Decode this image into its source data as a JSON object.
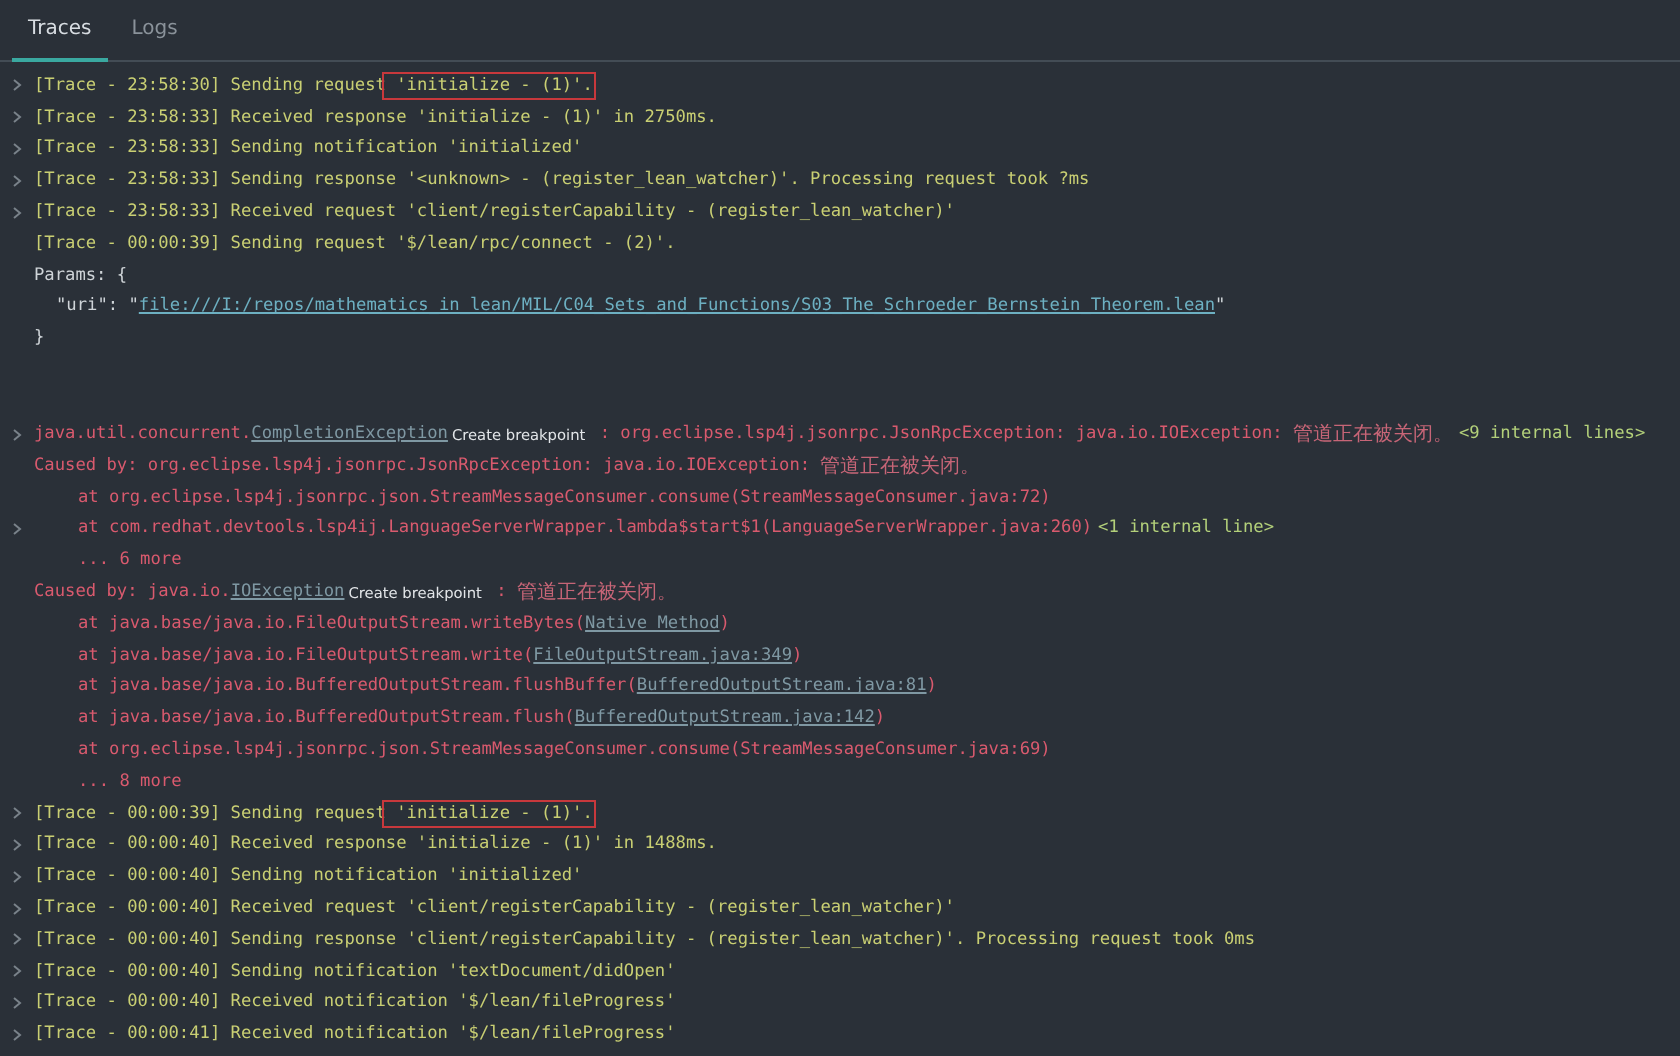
{
  "tabs": [
    {
      "label": "Traces",
      "selected": true
    },
    {
      "label": "Logs",
      "selected": false
    }
  ],
  "log": [
    {
      "kind": "trace",
      "expandable": true,
      "segments": [
        {
          "kind": "text",
          "text": "[Trace - 23:58:30] Sending request"
        },
        {
          "kind": "text",
          "text": " 'initialize - (1)'.",
          "boxed": true
        }
      ]
    },
    {
      "kind": "trace",
      "expandable": true,
      "segments": [
        {
          "kind": "text",
          "text": "[Trace - 23:58:33] Received response 'initialize - (1)' in 2750ms."
        }
      ]
    },
    {
      "kind": "trace",
      "expandable": true,
      "segments": [
        {
          "kind": "text",
          "text": "[Trace - 23:58:33] Sending notification 'initialized'"
        }
      ]
    },
    {
      "kind": "trace",
      "expandable": true,
      "segments": [
        {
          "kind": "text",
          "text": "[Trace - 23:58:33] Sending response '<unknown> - (register_lean_watcher)'. Processing request took ?ms"
        }
      ]
    },
    {
      "kind": "trace",
      "expandable": true,
      "segments": [
        {
          "kind": "text",
          "text": "[Trace - 23:58:33] Received request 'client/registerCapability - (register_lean_watcher)'"
        }
      ]
    },
    {
      "kind": "trace",
      "expandable": false,
      "segments": [
        {
          "kind": "text",
          "text": "[Trace - 00:00:39] Sending request '$/lean/rpc/connect - (2)'."
        }
      ]
    },
    {
      "kind": "plain",
      "expandable": false,
      "segments": [
        {
          "kind": "text",
          "text": "Params: {"
        }
      ]
    },
    {
      "kind": "param",
      "expandable": false,
      "segments": [
        {
          "kind": "text",
          "text": "\"uri\": \""
        },
        {
          "kind": "link",
          "text": "file:///I:/repos/mathematics_in_lean/MIL/C04_Sets_and_Functions/S03_The_Schroeder_Bernstein_Theorem.lean"
        },
        {
          "kind": "text",
          "text": "\""
        }
      ]
    },
    {
      "kind": "plain",
      "expandable": false,
      "segments": [
        {
          "kind": "text",
          "text": "}"
        }
      ]
    },
    {
      "kind": "exception",
      "expandable": true,
      "segments": [
        {
          "kind": "text",
          "text": "java.util.concurrent."
        },
        {
          "kind": "link",
          "text": "CompletionException"
        },
        {
          "kind": "action",
          "text": "Create breakpoint"
        },
        {
          "kind": "text",
          "text": " : org.eclipse.lsp4j.jsonrpc.JsonRpcException: java.io.IOException: "
        },
        {
          "kind": "cjk",
          "text": "管道正在被关闭。"
        },
        {
          "kind": "hint",
          "text": "<9 internal lines>"
        }
      ]
    },
    {
      "kind": "cause",
      "expandable": false,
      "segments": [
        {
          "kind": "text",
          "text": "Caused by: org.eclipse.lsp4j.jsonrpc.JsonRpcException: java.io.IOException: "
        },
        {
          "kind": "cjk",
          "text": "管道正在被关闭。"
        }
      ]
    },
    {
      "kind": "frame",
      "expandable": false,
      "segments": [
        {
          "kind": "text",
          "text": "at org.eclipse.lsp4j.jsonrpc.json.StreamMessageConsumer.consume(StreamMessageConsumer.java:72)"
        }
      ]
    },
    {
      "kind": "frame",
      "expandable": true,
      "segments": [
        {
          "kind": "text",
          "text": "at com.redhat.devtools.lsp4ij.LanguageServerWrapper.lambda$start$1(LanguageServerWrapper.java:260)"
        },
        {
          "kind": "hint",
          "text": "<1 internal line>"
        }
      ]
    },
    {
      "kind": "frame",
      "expandable": false,
      "segments": [
        {
          "kind": "text",
          "text": "... 6 more"
        }
      ]
    },
    {
      "kind": "cause",
      "expandable": false,
      "segments": [
        {
          "kind": "text",
          "text": "Caused by: java.io."
        },
        {
          "kind": "link",
          "text": "IOException"
        },
        {
          "kind": "action",
          "text": "Create breakpoint"
        },
        {
          "kind": "text",
          "text": " : "
        },
        {
          "kind": "cjk",
          "text": "管道正在被关闭。"
        }
      ]
    },
    {
      "kind": "frame",
      "expandable": false,
      "segments": [
        {
          "kind": "text",
          "text": "at java.base/java.io.FileOutputStream.writeBytes("
        },
        {
          "kind": "link",
          "text": "Native Method"
        },
        {
          "kind": "text",
          "text": ")"
        }
      ]
    },
    {
      "kind": "frame",
      "expandable": false,
      "segments": [
        {
          "kind": "text",
          "text": "at java.base/java.io.FileOutputStream.write("
        },
        {
          "kind": "link",
          "text": "FileOutputStream.java:349"
        },
        {
          "kind": "text",
          "text": ")"
        }
      ]
    },
    {
      "kind": "frame",
      "expandable": false,
      "segments": [
        {
          "kind": "text",
          "text": "at java.base/java.io.BufferedOutputStream.flushBuffer("
        },
        {
          "kind": "link",
          "text": "BufferedOutputStream.java:81"
        },
        {
          "kind": "text",
          "text": ")"
        }
      ]
    },
    {
      "kind": "frame",
      "expandable": false,
      "segments": [
        {
          "kind": "text",
          "text": "at java.base/java.io.BufferedOutputStream.flush("
        },
        {
          "kind": "link",
          "text": "BufferedOutputStream.java:142"
        },
        {
          "kind": "text",
          "text": ")"
        }
      ]
    },
    {
      "kind": "frame",
      "expandable": false,
      "segments": [
        {
          "kind": "text",
          "text": "at org.eclipse.lsp4j.jsonrpc.json.StreamMessageConsumer.consume(StreamMessageConsumer.java:69)"
        }
      ]
    },
    {
      "kind": "frame",
      "expandable": false,
      "segments": [
        {
          "kind": "text",
          "text": "... 8 more"
        }
      ]
    },
    {
      "kind": "trace",
      "expandable": true,
      "segments": [
        {
          "kind": "text",
          "text": "[Trace - 00:00:39] Sending request"
        },
        {
          "kind": "text",
          "text": " 'initialize - (1)'.",
          "boxed": true
        }
      ]
    },
    {
      "kind": "trace",
      "expandable": true,
      "segments": [
        {
          "kind": "text",
          "text": "[Trace - 00:00:40] Received response 'initialize - (1)' in 1488ms."
        }
      ]
    },
    {
      "kind": "trace",
      "expandable": true,
      "segments": [
        {
          "kind": "text",
          "text": "[Trace - 00:00:40] Sending notification 'initialized'"
        }
      ]
    },
    {
      "kind": "trace",
      "expandable": true,
      "segments": [
        {
          "kind": "text",
          "text": "[Trace - 00:00:40] Received request 'client/registerCapability - (register_lean_watcher)'"
        }
      ]
    },
    {
      "kind": "trace",
      "expandable": true,
      "segments": [
        {
          "kind": "text",
          "text": "[Trace - 00:00:40] Sending response 'client/registerCapability - (register_lean_watcher)'. Processing request took 0ms"
        }
      ]
    },
    {
      "kind": "trace",
      "expandable": true,
      "segments": [
        {
          "kind": "text",
          "text": "[Trace - 00:00:40] Sending notification 'textDocument/didOpen'"
        }
      ]
    },
    {
      "kind": "trace",
      "expandable": true,
      "segments": [
        {
          "kind": "text",
          "text": "[Trace - 00:00:40] Received notification '$/lean/fileProgress'"
        }
      ]
    },
    {
      "kind": "trace",
      "expandable": true,
      "segments": [
        {
          "kind": "text",
          "text": "[Trace - 00:00:41] Received notification '$/lean/fileProgress'"
        }
      ]
    }
  ]
}
